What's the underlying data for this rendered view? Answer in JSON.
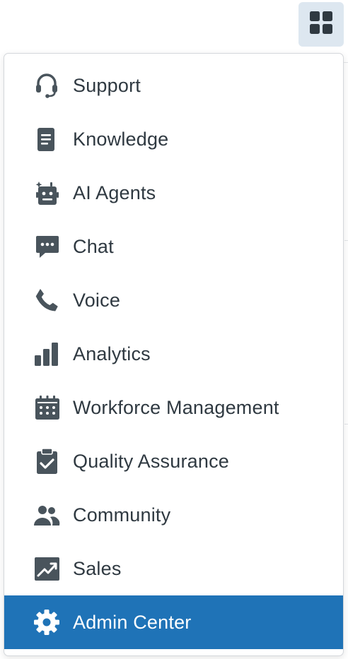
{
  "colors": {
    "icon": "#49545c",
    "text": "#2f3941",
    "active_bg": "#1f73b7",
    "active_text": "#ffffff",
    "apps_button_bg": "#dde7f0",
    "apps_icon": "#2f3941"
  },
  "apps_button": {
    "icon": "grid-icon"
  },
  "menu": {
    "items": [
      {
        "label": "Support",
        "icon": "headset-icon",
        "active": false
      },
      {
        "label": "Knowledge",
        "icon": "book-icon",
        "active": false
      },
      {
        "label": "AI Agents",
        "icon": "robot-icon",
        "active": false
      },
      {
        "label": "Chat",
        "icon": "chat-bubble-icon",
        "active": false
      },
      {
        "label": "Voice",
        "icon": "phone-icon",
        "active": false
      },
      {
        "label": "Analytics",
        "icon": "bar-chart-icon",
        "active": false
      },
      {
        "label": "Workforce Management",
        "icon": "calendar-icon",
        "active": false
      },
      {
        "label": "Quality Assurance",
        "icon": "clipboard-check-icon",
        "active": false
      },
      {
        "label": "Community",
        "icon": "people-icon",
        "active": false
      },
      {
        "label": "Sales",
        "icon": "trending-chart-icon",
        "active": false
      },
      {
        "label": "Admin Center",
        "icon": "gear-icon",
        "active": true
      }
    ]
  }
}
